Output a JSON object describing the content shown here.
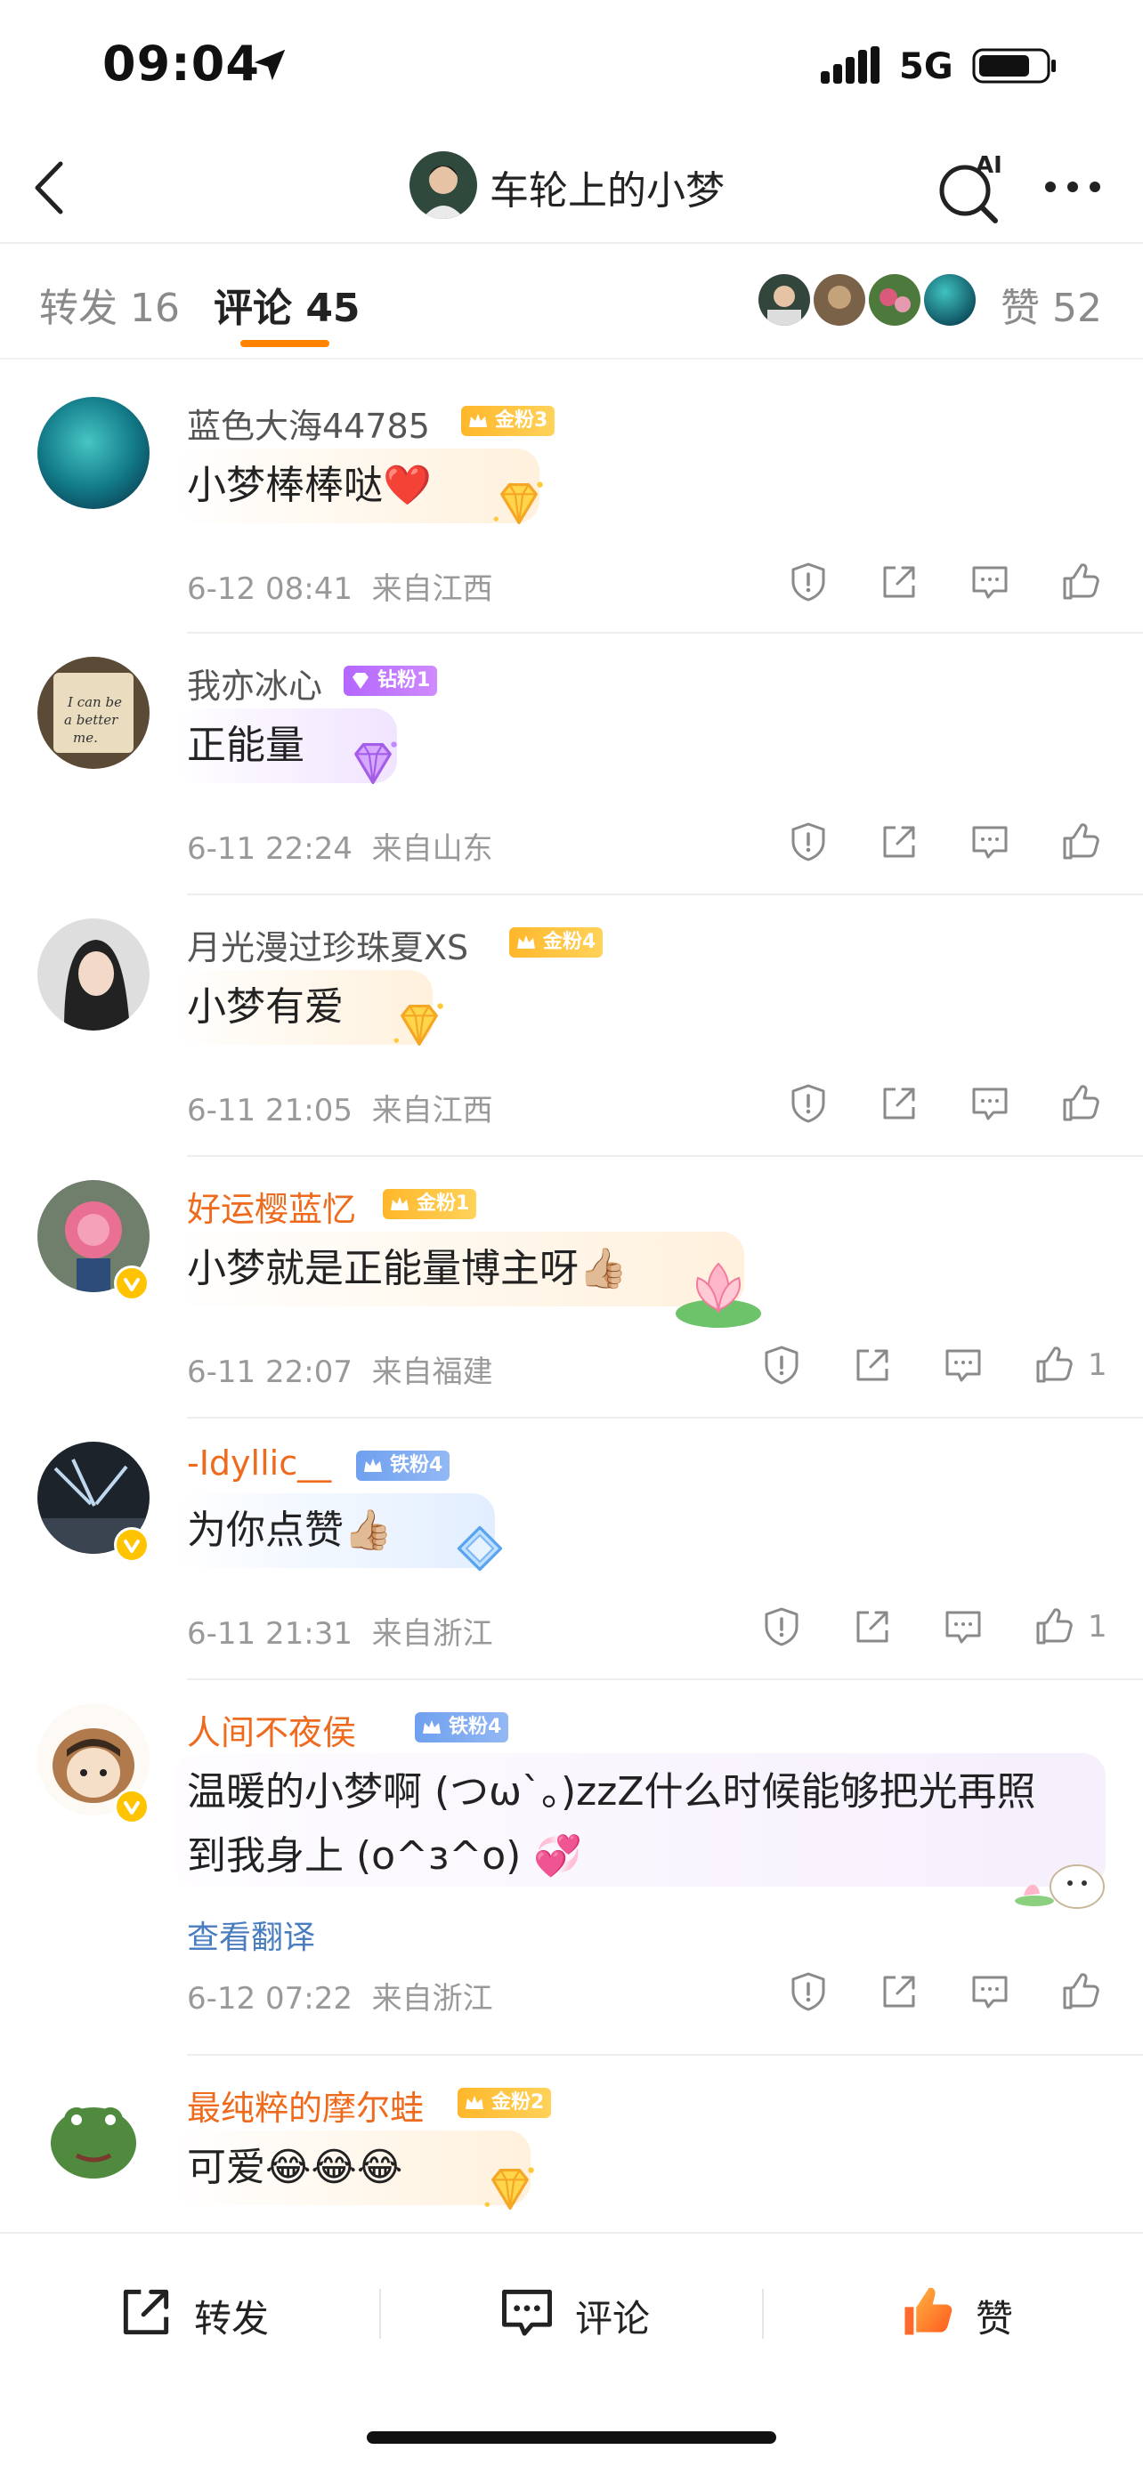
{
  "status": {
    "time": "09:04",
    "network": "5G"
  },
  "header": {
    "title": "车轮上的小梦"
  },
  "tabs": {
    "repost": "转发 16",
    "comment": "评论 45",
    "like": "赞 52"
  },
  "comments": [
    {
      "user": "蓝色大海44785",
      "badge": "金粉3",
      "text": "小梦棒棒哒❤️",
      "time": "6-12 08:41",
      "region": "来自江西",
      "likes": ""
    },
    {
      "user": "我亦冰心",
      "badge": "钻粉1",
      "text": "正能量",
      "time": "6-11 22:24",
      "region": "来自山东",
      "likes": ""
    },
    {
      "user": "月光漫过珍珠夏XS",
      "badge": "金粉4",
      "text": "小梦有爱",
      "time": "6-11 21:05",
      "region": "来自江西",
      "likes": ""
    },
    {
      "user": "好运樱蓝忆",
      "badge": "金粉1",
      "text": "小梦就是正能量博主呀👍🏼",
      "time": "6-11 22:07",
      "region": "来自福建",
      "likes": "1"
    },
    {
      "user": "-Idyllic__",
      "badge": "铁粉4",
      "text": "为你点赞👍🏼",
      "time": "6-11 21:31",
      "region": "来自浙江",
      "likes": "1"
    },
    {
      "user": "人间不夜侯",
      "badge": "铁粉4",
      "text_line1": "温暖的小梦啊 (つω`。)zzZ什么时候能够把光再照",
      "text_line2": "到我身上 (o^ɜ^o) 💞",
      "translate": "查看翻译",
      "time": "6-12 07:22",
      "region": "来自浙江",
      "likes": ""
    },
    {
      "user": "最纯粹的摩尔蛙",
      "badge": "金粉2",
      "text": "可爱😂😂😂"
    }
  ],
  "bottom": {
    "repost": "转发",
    "comment": "评论",
    "like": "赞"
  },
  "colors": {
    "accent": "#ff8200",
    "vip_name": "#ee6a1d",
    "link": "#4a7dbf",
    "meta": "#999999"
  }
}
